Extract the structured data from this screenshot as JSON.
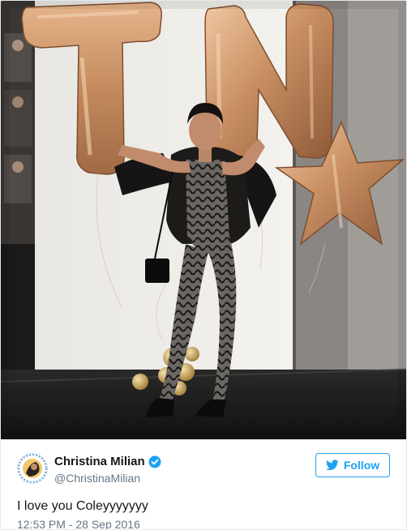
{
  "tweet": {
    "display_name": "Christina Milian",
    "handle": "@ChristinaMilian",
    "text": "I love you Coleyyyyyyy",
    "timestamp": "12:53 PM - 28 Sep 2016",
    "verified": true
  },
  "follow_button": {
    "label": "Follow",
    "icon": "twitter-bird-icon"
  },
  "photo": {
    "balloon_letters": [
      "T",
      "N",
      "★"
    ]
  },
  "colors": {
    "accent": "#1da1f2",
    "text_primary": "#14171a",
    "text_secondary": "#657786",
    "balloon_gold": "#d9a37a"
  }
}
